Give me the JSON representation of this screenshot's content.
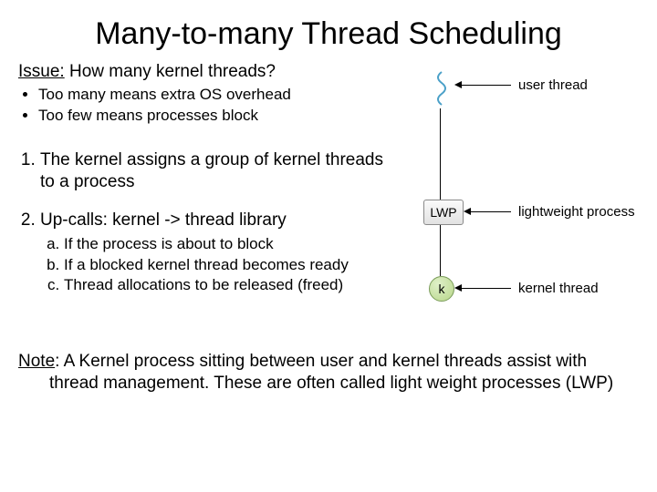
{
  "title": "Many-to-many Thread Scheduling",
  "issue": {
    "label": "Issue:",
    "text": " How many kernel threads?"
  },
  "issue_bullets": [
    "Too many means extra OS overhead",
    "Too few means processes block"
  ],
  "numbered": [
    {
      "text": "The kernel assigns a group of kernel threads to a process"
    },
    {
      "text": "Up-calls: kernel -> thread library",
      "sub": [
        "If the process is about to block",
        "If a blocked kernel thread becomes ready",
        "Thread allocations to be released (freed)"
      ]
    }
  ],
  "note": {
    "label": "Note",
    "text": ": A Kernel process sitting between user and kernel threads assist with thread management. These are often called light weight processes (LWP)"
  },
  "diagram": {
    "user_thread": "user thread",
    "lwp_box": "LWP",
    "lwp_label": "lightweight process",
    "k_box": "k",
    "kernel_thread": "kernel thread"
  }
}
